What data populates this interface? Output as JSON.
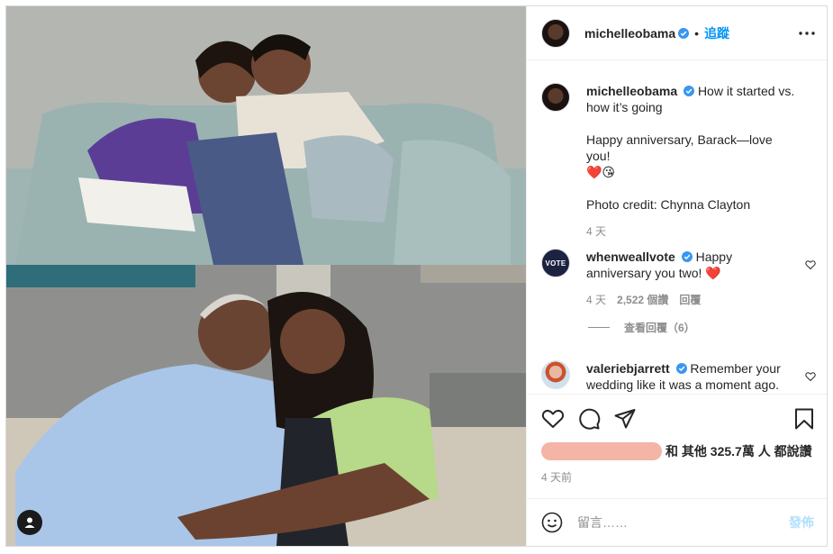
{
  "post": {
    "author": "michelleobama",
    "follow_label": "追蹤",
    "separator": "•",
    "more_icon": "more-horizontal-icon",
    "verified_color": "#3897f0",
    "accent_color": "#0095f6"
  },
  "caption": {
    "username": "michelleobama",
    "lines": [
      "How it started vs. how it’s going",
      "",
      "Happy anniversary, Barack—love you!",
      "❤️😘",
      "",
      "Photo credit: Chynna Clayton"
    ],
    "line_1": "How it started vs. how it’s going",
    "line_2": "Happy anniversary, Barack—love you!",
    "line_3": "❤️😘",
    "line_4": "Photo credit: Chynna Clayton",
    "time": "4 天"
  },
  "comments": [
    {
      "username": "whenweallvote",
      "avatar_text": "VOTE",
      "text": "Happy anniversary you two! ❤️",
      "time": "4 天",
      "likes": "2,522 個讚",
      "reply_label": "回覆"
    },
    {
      "username": "valeriebjarrett",
      "text": "Remember your wedding like it was a moment ago."
    }
  ],
  "view_replies": "查看回覆（6）",
  "actions": {
    "like_icon": "heart-icon",
    "comment_icon": "comment-icon",
    "share_icon": "share-icon",
    "save_icon": "bookmark-icon"
  },
  "likes_text": "和 其他 325.7萬 人 都說讚",
  "posted_ago": "4 天前",
  "comment_box": {
    "placeholder": "留言……",
    "post_label": "發佈",
    "emoji_icon": "emoji-icon"
  }
}
